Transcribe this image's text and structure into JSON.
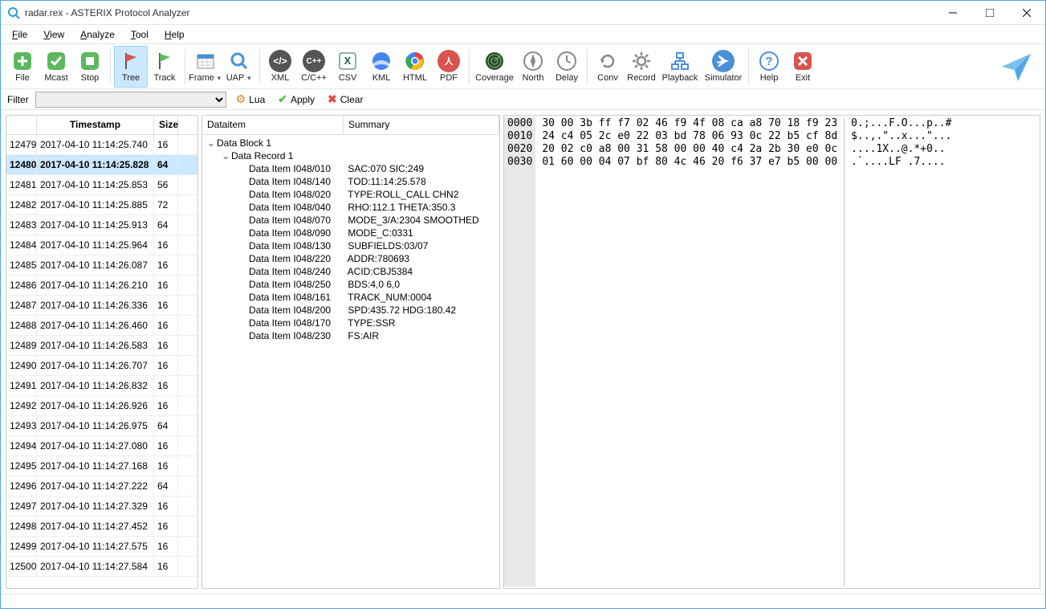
{
  "window": {
    "title": "radar.rex - ASTERIX Protocol Analyzer"
  },
  "menu": {
    "items": [
      "File",
      "View",
      "Analyze",
      "Tool",
      "Help"
    ]
  },
  "toolbar": {
    "file": "File",
    "mcast": "Mcast",
    "stop": "Stop",
    "tree": "Tree",
    "track": "Track",
    "frame": "Frame",
    "uap": "UAP",
    "xml": "XML",
    "ccpp": "C/C++",
    "csv": "CSV",
    "kml": "KML",
    "html": "HTML",
    "pdf": "PDF",
    "coverage": "Coverage",
    "north": "North",
    "delay": "Delay",
    "conv": "Conv",
    "record": "Record",
    "playback": "Playback",
    "simulator": "Simulator",
    "help": "Help",
    "exit": "Exit"
  },
  "filterbar": {
    "label": "Filter",
    "lua": "Lua",
    "apply": "Apply",
    "clear": "Clear"
  },
  "table": {
    "headers": {
      "timestamp": "Timestamp",
      "size": "Size"
    },
    "selected_index": "12480",
    "rows": [
      {
        "idx": "12479",
        "ts": "2017-04-10 11:14:25.740",
        "sz": "16"
      },
      {
        "idx": "12480",
        "ts": "2017-04-10 11:14:25.828",
        "sz": "64"
      },
      {
        "idx": "12481",
        "ts": "2017-04-10 11:14:25.853",
        "sz": "56"
      },
      {
        "idx": "12482",
        "ts": "2017-04-10 11:14:25.885",
        "sz": "72"
      },
      {
        "idx": "12483",
        "ts": "2017-04-10 11:14:25.913",
        "sz": "64"
      },
      {
        "idx": "12484",
        "ts": "2017-04-10 11:14:25.964",
        "sz": "16"
      },
      {
        "idx": "12485",
        "ts": "2017-04-10 11:14:26.087",
        "sz": "16"
      },
      {
        "idx": "12486",
        "ts": "2017-04-10 11:14:26.210",
        "sz": "16"
      },
      {
        "idx": "12487",
        "ts": "2017-04-10 11:14:26.336",
        "sz": "16"
      },
      {
        "idx": "12488",
        "ts": "2017-04-10 11:14:26.460",
        "sz": "16"
      },
      {
        "idx": "12489",
        "ts": "2017-04-10 11:14:26.583",
        "sz": "16"
      },
      {
        "idx": "12490",
        "ts": "2017-04-10 11:14:26.707",
        "sz": "16"
      },
      {
        "idx": "12491",
        "ts": "2017-04-10 11:14:26.832",
        "sz": "16"
      },
      {
        "idx": "12492",
        "ts": "2017-04-10 11:14:26.926",
        "sz": "16"
      },
      {
        "idx": "12493",
        "ts": "2017-04-10 11:14:26.975",
        "sz": "64"
      },
      {
        "idx": "12494",
        "ts": "2017-04-10 11:14:27.080",
        "sz": "16"
      },
      {
        "idx": "12495",
        "ts": "2017-04-10 11:14:27.168",
        "sz": "16"
      },
      {
        "idx": "12496",
        "ts": "2017-04-10 11:14:27.222",
        "sz": "64"
      },
      {
        "idx": "12497",
        "ts": "2017-04-10 11:14:27.329",
        "sz": "16"
      },
      {
        "idx": "12498",
        "ts": "2017-04-10 11:14:27.452",
        "sz": "16"
      },
      {
        "idx": "12499",
        "ts": "2017-04-10 11:14:27.575",
        "sz": "16"
      },
      {
        "idx": "12500",
        "ts": "2017-04-10 11:14:27.584",
        "sz": "16"
      }
    ]
  },
  "tree": {
    "headers": {
      "dataitem": "Dataitem",
      "summary": "Summary"
    },
    "block": "Data Block 1",
    "record": "Data Record 1",
    "items": [
      {
        "lbl": "Data Item I048/010",
        "sum": "SAC:070 SIC:249"
      },
      {
        "lbl": "Data Item I048/140",
        "sum": "TOD:11:14:25.578"
      },
      {
        "lbl": "Data Item I048/020",
        "sum": "TYPE:ROLL_CALL CHN2"
      },
      {
        "lbl": "Data Item I048/040",
        "sum": "RHO:112.1 THETA:350.3"
      },
      {
        "lbl": "Data Item I048/070",
        "sum": "MODE_3/A:2304 SMOOTHED"
      },
      {
        "lbl": "Data Item I048/090",
        "sum": "MODE_C:0331"
      },
      {
        "lbl": "Data Item I048/130",
        "sum": "SUBFIELDS:03/07"
      },
      {
        "lbl": "Data Item I048/220",
        "sum": "ADDR:780693"
      },
      {
        "lbl": "Data Item I048/240",
        "sum": "ACID:CBJ5384"
      },
      {
        "lbl": "Data Item I048/250",
        "sum": "BDS:4,0 6,0"
      },
      {
        "lbl": "Data Item I048/161",
        "sum": "TRACK_NUM:0004"
      },
      {
        "lbl": "Data Item I048/200",
        "sum": "SPD:435.72 HDG:180.42"
      },
      {
        "lbl": "Data Item I048/170",
        "sum": "TYPE:SSR"
      },
      {
        "lbl": "Data Item I048/230",
        "sum": "FS:AIR"
      }
    ]
  },
  "hex": {
    "offsets": [
      "0000",
      "0010",
      "0020",
      "0030"
    ],
    "bytes": [
      "30 00 3b ff f7 02 46 f9 4f 08 ca a8 70 18 f9 23",
      "24 c4 05 2c e0 22 03 bd 78 06 93 0c 22 b5 cf 8d",
      "20 02 c0 a8 00 31 58 00 00 40 c4 2a 2b 30 e0 0c",
      "01 60 00 04 07 bf 80 4c 46 20 f6 37 e7 b5 00 00"
    ],
    "ascii": [
      "0.;...F.O...p..#",
      "$..,.\"..x...\"...",
      "....1X..@.*+0..",
      ".`....LF .7...."
    ]
  }
}
